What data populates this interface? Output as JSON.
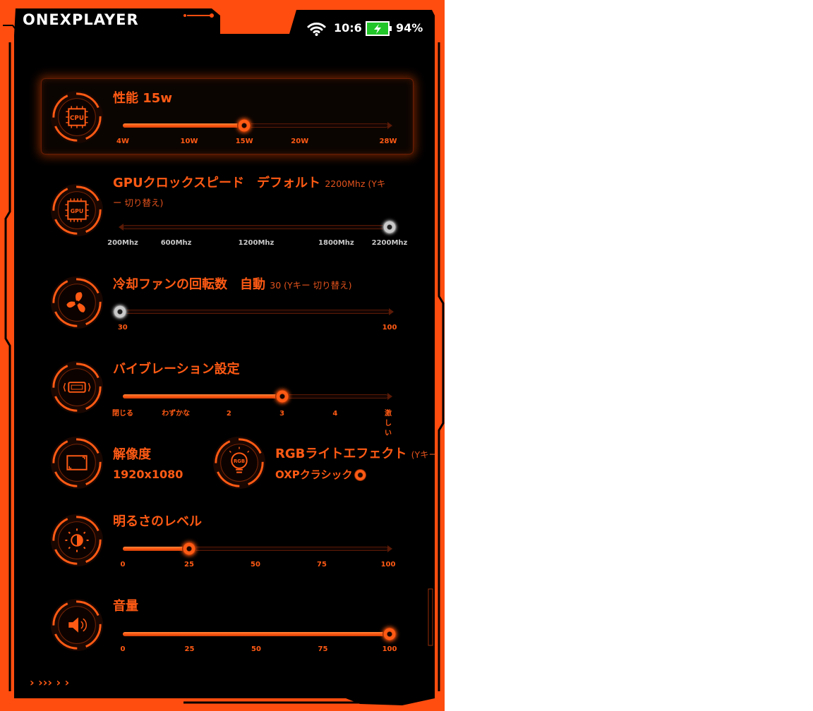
{
  "brand": {
    "logo": "ONEXPLAYER"
  },
  "status_bar": {
    "time": "10:6",
    "battery": "94%"
  },
  "colors": {
    "accent": "#ff5a14",
    "dark": "#000000",
    "grey_knob": "#c9c9c9"
  },
  "settings": {
    "tdp": {
      "title": "性能 15w",
      "value": 0.458,
      "ticks": [
        "4W",
        "10W",
        "15W",
        "20W",
        "28W"
      ]
    },
    "gpu": {
      "title": "GPUクロックスピード　デフォルト",
      "note_a": "2200Mhz (Yキ",
      "note_b": "ー 切り替え)",
      "value": 1.0,
      "ticks": [
        "200Mhz",
        "600Mhz",
        "1200Mhz",
        "1800Mhz",
        "2200Mhz"
      ]
    },
    "fan": {
      "title": "冷却ファンの回転数　自動",
      "note": "30 (Yキー 切り替え)",
      "value": 0,
      "ticks": [
        "30",
        "100"
      ]
    },
    "vibration": {
      "title": "バイブレーション設定",
      "value": 0.6,
      "ticks": [
        "閉じる",
        "わずかな",
        "2",
        "3",
        "4",
        "激",
        "し",
        "い"
      ]
    },
    "resolution": {
      "title": "解像度",
      "value": "1920x1080"
    },
    "rgb": {
      "title": "RGBライトエフェクト",
      "note": "(Yキー",
      "value": "OXPクラシック"
    },
    "brightness": {
      "title": "明るさのレベル",
      "value": 25,
      "ticks": [
        "0",
        "25",
        "50",
        "75",
        "100"
      ]
    },
    "volume": {
      "title": "音量",
      "value": 100,
      "ticks": [
        "0",
        "25",
        "50",
        "75",
        "100"
      ]
    }
  },
  "footer": {
    "chevrons": "›  ›››  ›  ›"
  },
  "icons": [
    "wifi-icon",
    "battery-icon",
    "cpu-icon",
    "gpu-icon",
    "fan-icon",
    "vibration-icon",
    "screen-icon",
    "rgb-bulb-icon",
    "brightness-icon",
    "speaker-icon"
  ]
}
